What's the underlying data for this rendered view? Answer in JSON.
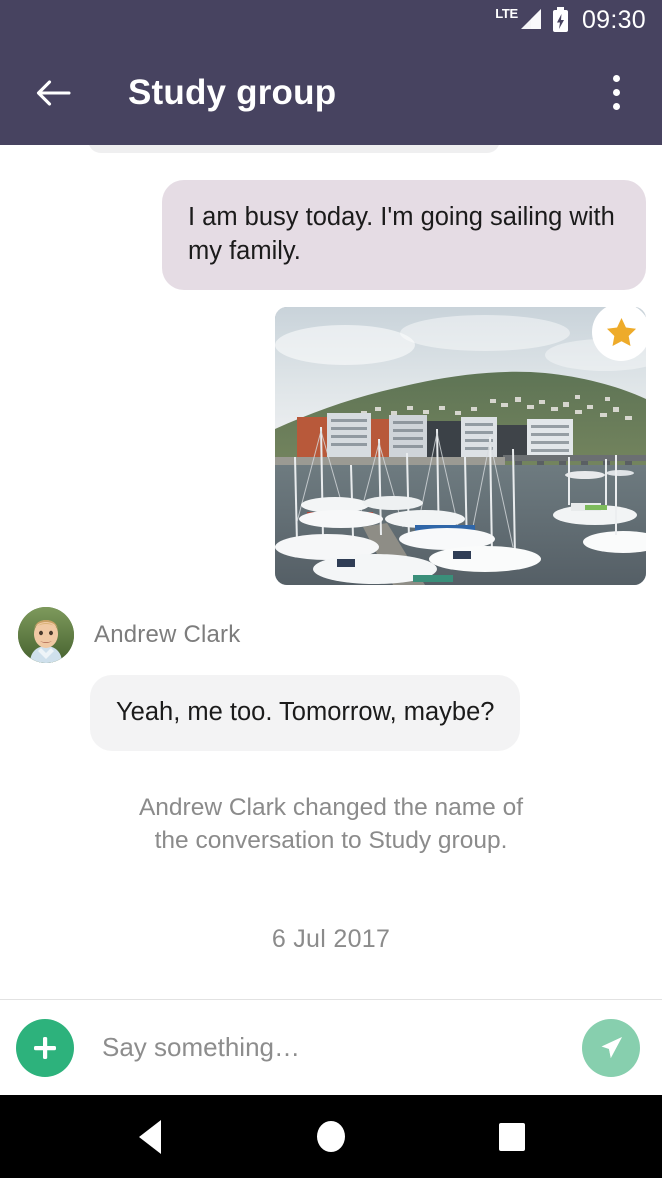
{
  "status_bar": {
    "network_label": "LTE",
    "signal_icon": "signal-bars-icon",
    "battery_icon": "battery-charging-icon",
    "time": "09:30"
  },
  "app_bar": {
    "back_icon": "back-arrow-icon",
    "title": "Study group",
    "overflow_icon": "more-vertical-icon"
  },
  "conversation": {
    "outgoing_message": {
      "text": "I am busy today. I'm going sailing with my family.",
      "bubble_color": "#e5dce4",
      "text_color": "#1b1b1b"
    },
    "attachment": {
      "type": "photo",
      "description": "Marina harbour with sailboats, waterfront buildings and a green hill with houses",
      "starred": true,
      "star_icon": "star-icon",
      "star_color": "#eeab2a"
    },
    "incoming_message": {
      "sender": "Andrew Clark",
      "avatar_icon": "avatar-andrew-clark",
      "text": "Yeah, me too. Tomorrow, maybe?",
      "bubble_color": "#f3f3f4",
      "name_color": "#7d7d7d"
    },
    "system_message": "Andrew Clark changed the name of the conversation to Study group.",
    "date_separator": "6 Jul 2017"
  },
  "composer": {
    "add_icon": "plus-icon",
    "add_color": "#2db27c",
    "placeholder": "Say something…",
    "value": "",
    "send_icon": "send-paper-plane-icon",
    "send_color": "#87cfae"
  },
  "nav_bar": {
    "back_icon": "nav-back-triangle-icon",
    "home_icon": "nav-home-circle-icon",
    "recents_icon": "nav-recents-square-icon"
  },
  "theme": {
    "app_bar_color": "#474360",
    "background": "#ffffff"
  }
}
